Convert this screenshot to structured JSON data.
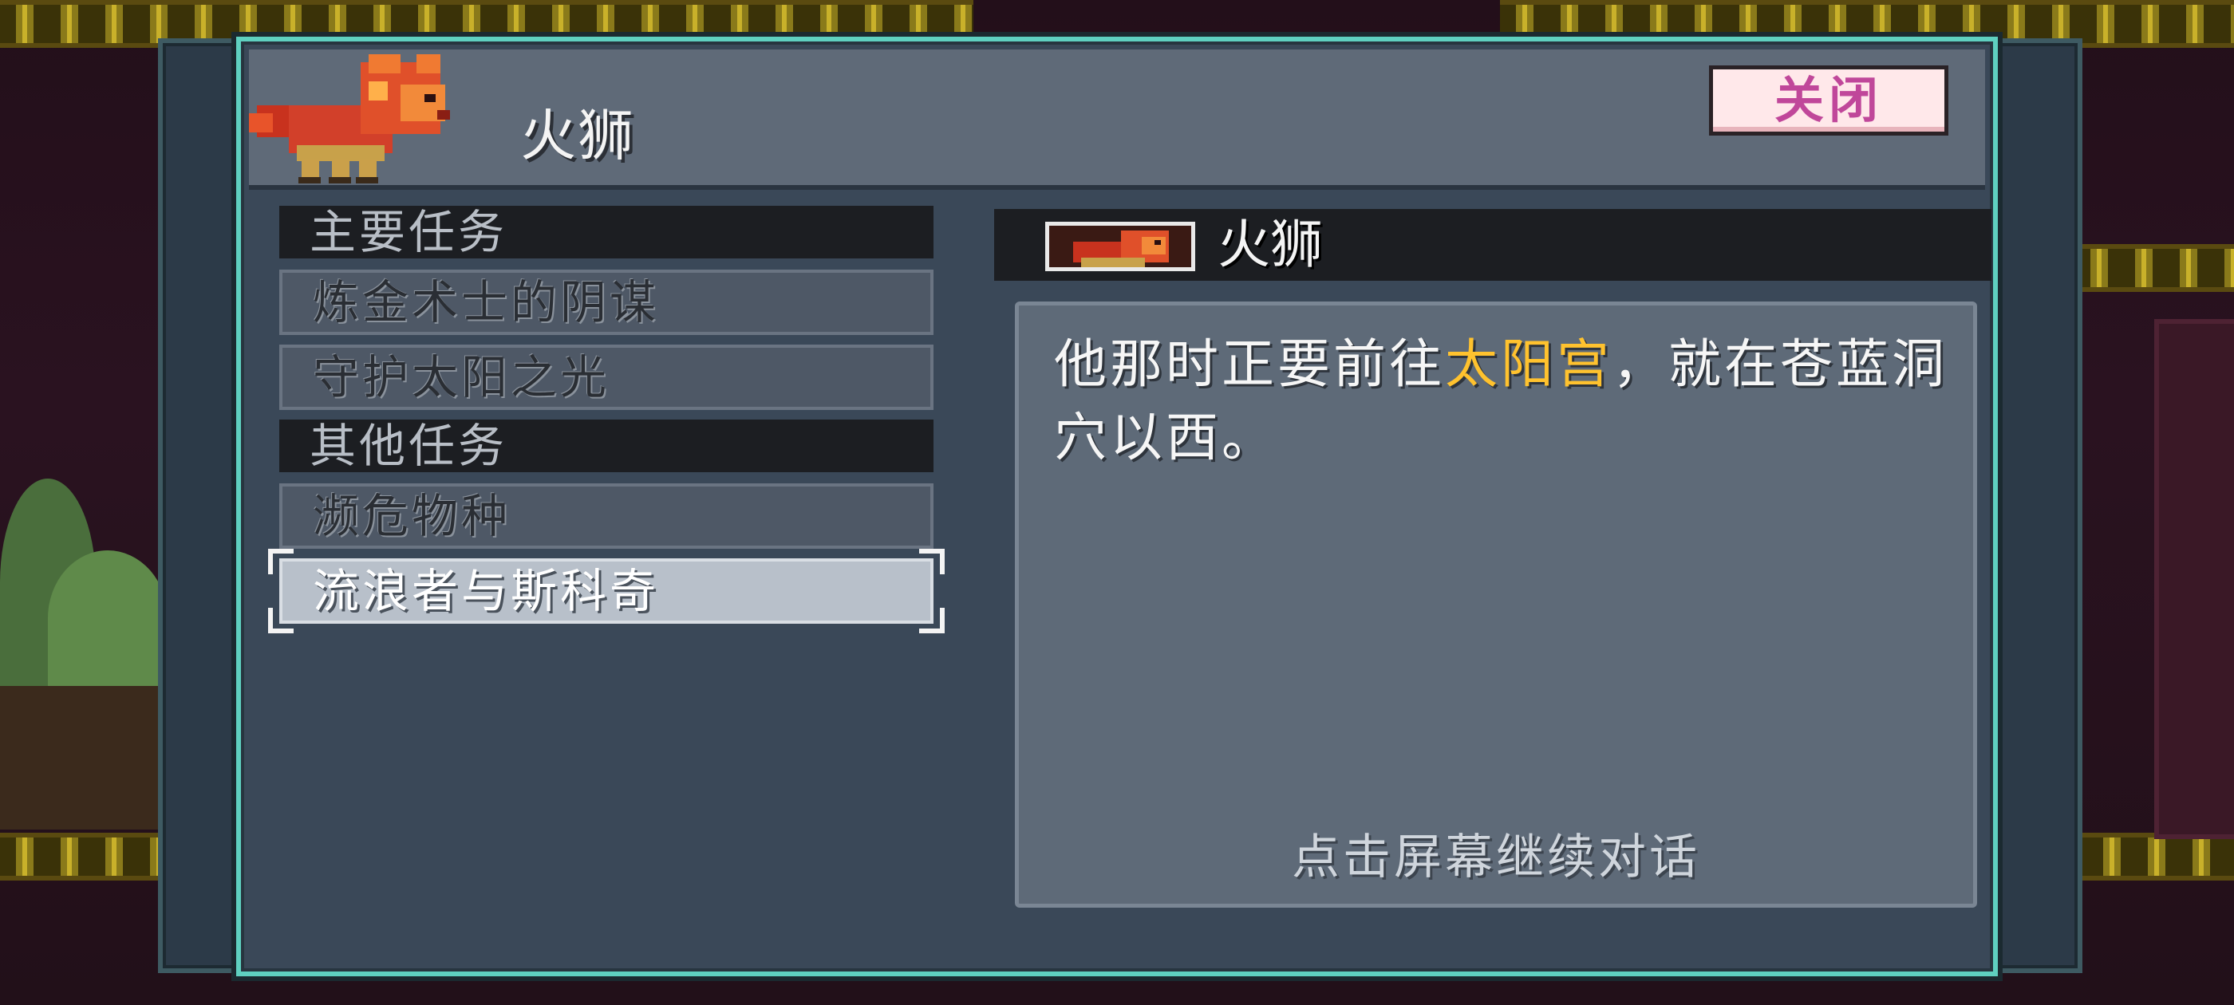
{
  "npc": {
    "name": "火狮",
    "portrait_icon": "fire-lion-icon"
  },
  "header": {
    "close_label": "关闭"
  },
  "quests": {
    "main_header": "主要任务",
    "main_items": [
      "炼金术士的阴谋",
      "守护太阳之光"
    ],
    "other_header": "其他任务",
    "other_items": [
      "濒危物种",
      "流浪者与斯科奇"
    ],
    "selected": "流浪者与斯科奇"
  },
  "dialogue": {
    "speaker": "火狮",
    "text_before": "他那时正要前往",
    "highlight": "太阳宫",
    "text_after": "，就在苍蓝洞穴以西。",
    "continue_hint": "点击屏幕继续对话",
    "highlight_color": "#ffc22e"
  },
  "colors": {
    "dialog_border": "#5fd0c0",
    "close_text": "#c0479a"
  }
}
